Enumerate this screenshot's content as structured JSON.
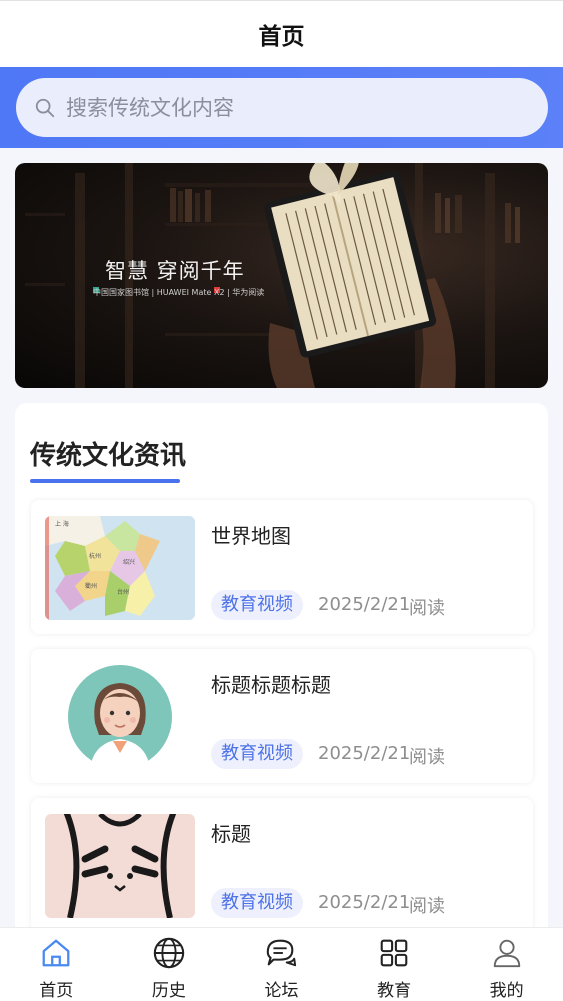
{
  "header": {
    "title": "首页"
  },
  "search": {
    "placeholder": "搜索传统文化内容",
    "icon": "search-icon"
  },
  "banner": {
    "slogan": "智慧 穿阅千年",
    "sub": "中国国家图书馆  |  HUAWEI Mate X2  |  华为阅读"
  },
  "news": {
    "title": "传统文化资讯",
    "items": [
      {
        "title": "世界地图",
        "tag": "教育视频",
        "date": "2025/2/21",
        "action": "阅读",
        "thumb": "map-image"
      },
      {
        "title": "标题标题标题",
        "tag": "教育视频",
        "date": "2025/2/21",
        "action": "阅读",
        "thumb": "doctor-avatar-image"
      },
      {
        "title": "标题",
        "tag": "教育视频",
        "date": "2025/2/21",
        "action": "阅读",
        "thumb": "cartoon-image"
      }
    ]
  },
  "tabbar": {
    "items": [
      {
        "label": "首页",
        "icon": "home-icon",
        "active": true
      },
      {
        "label": "历史",
        "icon": "globe-icon",
        "active": false
      },
      {
        "label": "论坛",
        "icon": "chat-icon",
        "active": false
      },
      {
        "label": "教育",
        "icon": "grid-icon",
        "active": false
      },
      {
        "label": "我的",
        "icon": "user-icon",
        "active": false
      }
    ]
  },
  "colors": {
    "accent": "#4a72ee",
    "band": "#5479f7",
    "tag_bg": "#eef1fd"
  }
}
